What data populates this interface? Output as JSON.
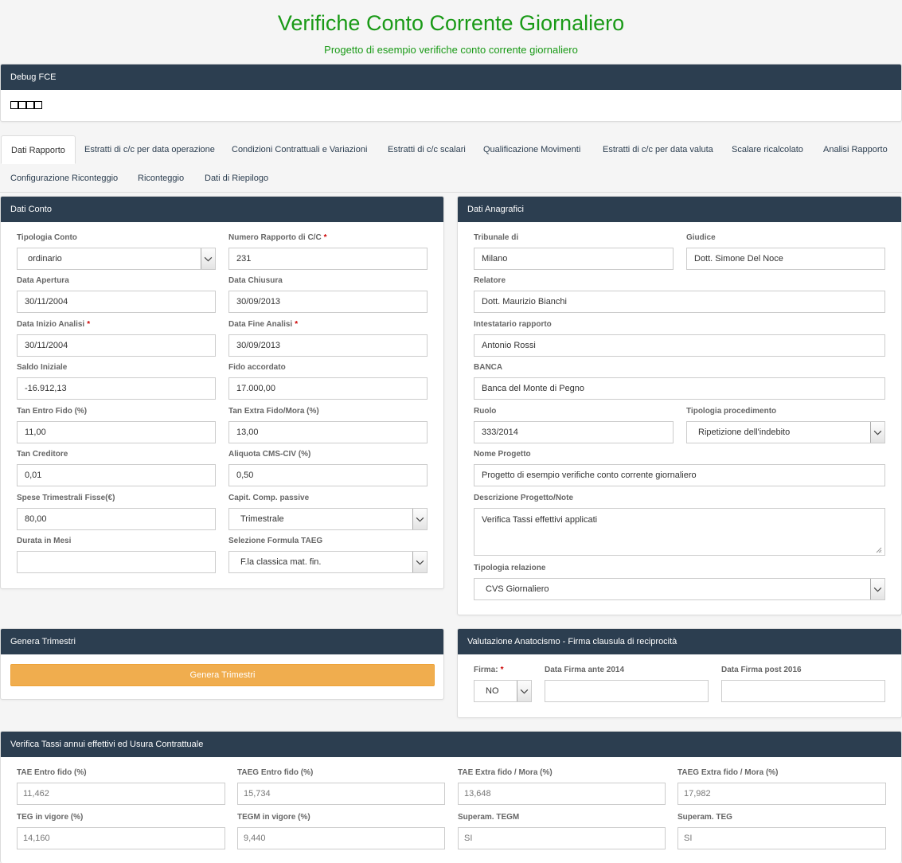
{
  "header": {
    "title": "Verifiche Conto Corrente Giornaliero",
    "subtitle": "Progetto di esempio verifiche conto corrente giornaliero"
  },
  "debug": {
    "title": "Debug FCE"
  },
  "tabs": [
    "Dati Rapporto",
    "Estratti di c/c per data operazione",
    "Condizioni Contrattuali e Variazioni",
    "Estratti di c/c scalari",
    "Qualificazione Movimenti",
    "Estratti di c/c per data valuta",
    "Scalare ricalcolato",
    "Analisi Rapporto",
    "Configurazione Riconteggio",
    "Riconteggio",
    "Dati di Riepilogo"
  ],
  "dati_conto": {
    "title": "Dati Conto",
    "tipologia_conto": {
      "label": "Tipologia Conto",
      "value": "ordinario"
    },
    "numero_rapporto": {
      "label": "Numero Rapporto di C/C",
      "value": "231"
    },
    "data_apertura": {
      "label": "Data Apertura",
      "value": "30/11/2004"
    },
    "data_chiusura": {
      "label": "Data Chiusura",
      "value": "30/09/2013"
    },
    "data_inizio": {
      "label": "Data Inizio Analisi",
      "value": "30/11/2004"
    },
    "data_fine": {
      "label": "Data Fine Analisi",
      "value": "30/09/2013"
    },
    "saldo_iniziale": {
      "label": "Saldo Iniziale",
      "value": "-16.912,13"
    },
    "fido_accordato": {
      "label": "Fido accordato",
      "value": "17.000,00"
    },
    "tan_entro": {
      "label": "Tan Entro Fido (%)",
      "value": "11,00"
    },
    "tan_extra": {
      "label": "Tan Extra Fido/Mora (%)",
      "value": "13,00"
    },
    "tan_creditore": {
      "label": "Tan Creditore",
      "value": "0,01"
    },
    "aliquota": {
      "label": "Aliquota CMS-CIV (%)",
      "value": "0,50"
    },
    "spese": {
      "label": "Spese Trimestrali Fisse(€)",
      "value": "80,00"
    },
    "capit": {
      "label": "Capit. Comp. passive",
      "value": "Trimestrale"
    },
    "durata": {
      "label": "Durata in Mesi",
      "value": ""
    },
    "formula_taeg": {
      "label": "Selezione Formula TAEG",
      "value": "F.la classica mat. fin."
    }
  },
  "dati_anagrafici": {
    "title": "Dati Anagrafici",
    "tribunale": {
      "label": "Tribunale di",
      "value": "Milano"
    },
    "giudice": {
      "label": "Giudice",
      "value": "Dott. Simone Del Noce"
    },
    "relatore": {
      "label": "Relatore",
      "value": "Dott. Maurizio Bianchi"
    },
    "intestatario": {
      "label": "Intestatario rapporto",
      "value": "Antonio Rossi"
    },
    "banca": {
      "label": "BANCA",
      "value": "Banca del Monte di Pegno"
    },
    "ruolo": {
      "label": "Ruolo",
      "value": "333/2014"
    },
    "tipologia_procedimento": {
      "label": "Tipologia procedimento",
      "value": "Ripetizione dell'indebito"
    },
    "nome_progetto": {
      "label": "Nome Progetto",
      "value": "Progetto di esempio verifiche conto corrente giornaliero"
    },
    "descrizione": {
      "label": "Descrizione Progetto/Note",
      "value": "Verifica Tassi effettivi applicati"
    },
    "tipologia_relazione": {
      "label": "Tipologia relazione",
      "value": "CVS Giornaliero"
    }
  },
  "genera": {
    "title": "Genera Trimestri",
    "button": "Genera Trimestri"
  },
  "anatocismo": {
    "title": "Valutazione Anatocismo - Firma clausula di reciprocità",
    "firma": {
      "label": "Firma:",
      "value": "NO"
    },
    "ante": {
      "label": "Data Firma ante 2014",
      "value": ""
    },
    "post": {
      "label": "Data Firma post 2016",
      "value": ""
    }
  },
  "tassi": {
    "title": "Verifica Tassi annui effettivi ed Usura Contrattuale",
    "tae_entro": {
      "label": "TAE Entro fido (%)",
      "value": "11,462"
    },
    "taeg_entro": {
      "label": "TAEG Entro fido (%)",
      "value": "15,734"
    },
    "tae_extra": {
      "label": "TAE Extra fido / Mora (%)",
      "value": "13,648"
    },
    "taeg_extra": {
      "label": "TAEG Extra fido / Mora (%)",
      "value": "17,982"
    },
    "teg": {
      "label": "TEG in vigore (%)",
      "value": "14,160"
    },
    "tegm": {
      "label": "TEGM in vigore (%)",
      "value": "9,440"
    },
    "superam_tegm": {
      "label": "Superam. TEGM",
      "value": "SI"
    },
    "superam_teg": {
      "label": "Superam. TEG",
      "value": "SI"
    }
  }
}
